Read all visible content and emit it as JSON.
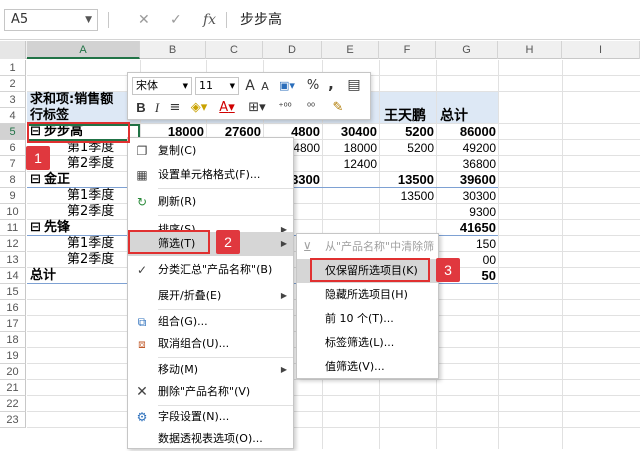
{
  "formula_bar": {
    "name_box": "A5",
    "formula": "步步高",
    "cancel_icon": "close-icon",
    "enter_icon": "check-icon",
    "fx_label": "fx"
  },
  "columns": [
    "A",
    "B",
    "C",
    "D",
    "E",
    "F",
    "G",
    "H",
    "I"
  ],
  "active_column": "A",
  "rows": [
    "1",
    "2",
    "3",
    "4",
    "5",
    "6",
    "7",
    "8",
    "9",
    "10",
    "11",
    "12",
    "13",
    "14",
    "15",
    "16",
    "17",
    "18",
    "19",
    "20",
    "21",
    "22",
    "23"
  ],
  "active_row": "5",
  "sheet": {
    "r3": {
      "a": "求和项:销售额",
      "f": "王天鹏",
      "g": "总计"
    },
    "r4": {
      "a": "行标签"
    },
    "r5": {
      "a": "步步高",
      "b": "18000",
      "c": "27600",
      "d": "4800",
      "e": "30400",
      "f": "5200",
      "g": "86000"
    },
    "r6": {
      "a": "第1季度",
      "d": "4800",
      "e": "18000",
      "f": "5200",
      "g": "49200"
    },
    "r7": {
      "a": "第2季度",
      "e": "12400",
      "g": "36800"
    },
    "r8": {
      "a": "金正",
      "d": "3300",
      "f": "13500",
      "g": "39600"
    },
    "r9": {
      "a": "第1季度",
      "f": "13500",
      "g": "30300"
    },
    "r10": {
      "a": "第2季度",
      "g": "9300"
    },
    "r11": {
      "a": "先锋",
      "g": "41650"
    },
    "r12": {
      "a": "第1季度",
      "g": "150"
    },
    "r13": {
      "a": "第2季度",
      "g": "00"
    },
    "r14": {
      "a": "总计",
      "g": "50"
    }
  },
  "mini_toolbar": {
    "font_name": "宋体",
    "font_size": "11",
    "grow_font": "A",
    "shrink_font": "A",
    "percent": "%",
    "comma": ",",
    "bold": "B",
    "italic": "I",
    "font_color": "A"
  },
  "context_menu": {
    "items": [
      {
        "label": "复制(C)",
        "icon": "copy-icon"
      },
      {
        "label": "设置单元格格式(F)...",
        "icon": "format-cells-icon"
      },
      {
        "label": "刷新(R)",
        "icon": "refresh-icon"
      },
      {
        "label": "排序(S)",
        "icon": ""
      },
      {
        "label": "筛选(T)",
        "icon": ""
      },
      {
        "label": "分类汇总\"产品名称\"(B)",
        "icon": "check-icon"
      },
      {
        "label": "展开/折叠(E)",
        "icon": ""
      },
      {
        "label": "组合(G)...",
        "icon": "group-icon"
      },
      {
        "label": "取消组合(U)...",
        "icon": "ungroup-icon"
      },
      {
        "label": "移动(M)",
        "icon": ""
      },
      {
        "label": "删除\"产品名称\"(V)",
        "icon": "delete-icon"
      },
      {
        "label": "字段设置(N)...",
        "icon": "field-settings-icon"
      },
      {
        "label": "数据透视表选项(O)...",
        "icon": ""
      }
    ]
  },
  "filter_submenu": {
    "items": [
      {
        "label": "从\"产品名称\"中清除筛选(C)",
        "icon": "clear-filter-icon"
      },
      {
        "label": "仅保留所选项目(K)"
      },
      {
        "label": "隐藏所选项目(H)"
      },
      {
        "label": "前 10 个(T)..."
      },
      {
        "label": "标签筛选(L)..."
      },
      {
        "label": "值筛选(V)..."
      }
    ]
  },
  "badges": [
    "1",
    "2",
    "3"
  ],
  "colors": {
    "accent": "#217346",
    "annotation": "#e0383e",
    "header_band": "#dde8f5"
  }
}
